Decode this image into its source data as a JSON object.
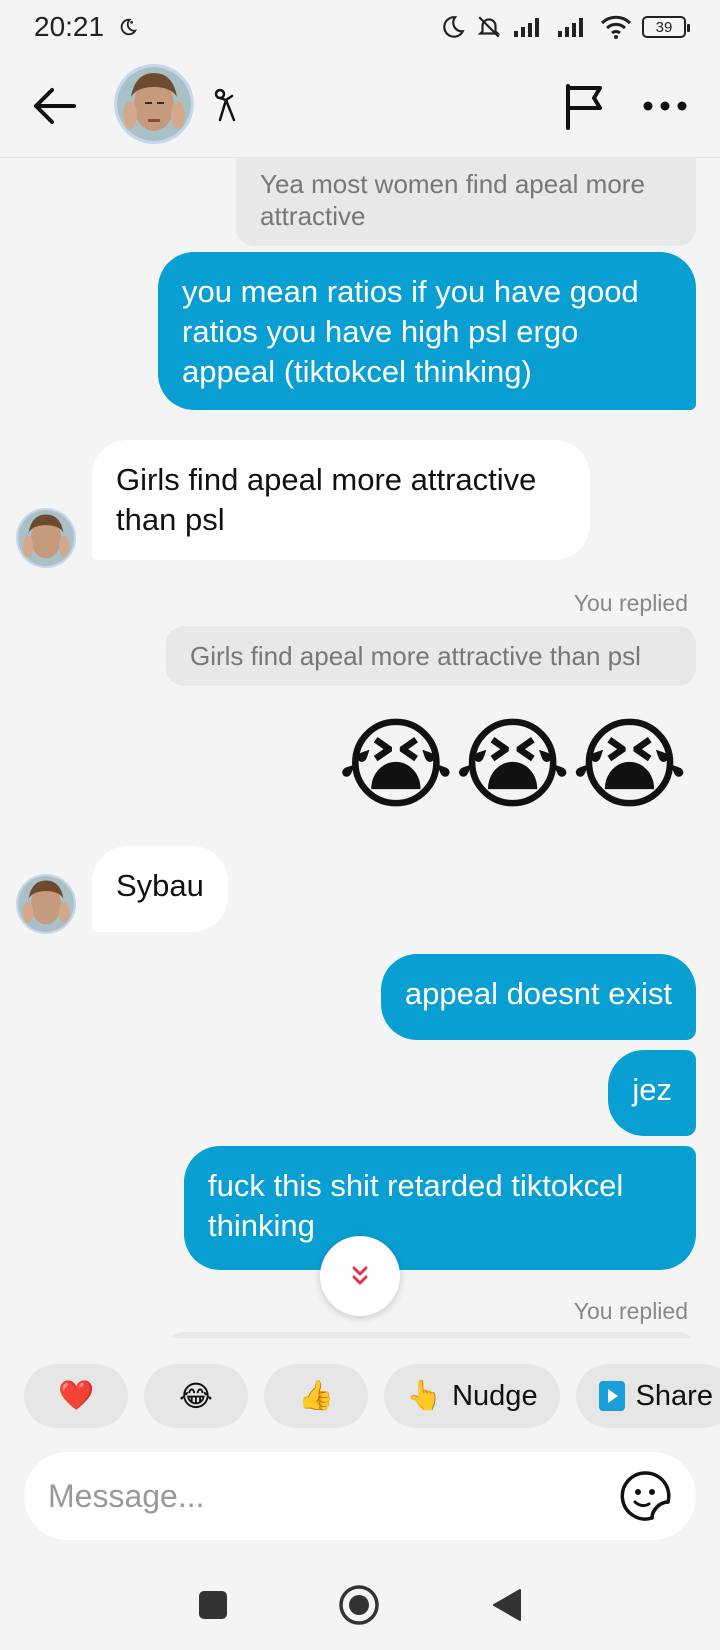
{
  "status_bar": {
    "time": "20:21",
    "battery": "39",
    "icons": [
      "moon-icon",
      "bell-off-icon",
      "signal-icon",
      "signal-icon",
      "wifi-icon",
      "battery-icon"
    ]
  },
  "header": {
    "back_icon": "arrow-left-icon",
    "avatar": "contact-avatar",
    "badge_icon": "stick-figure-icon",
    "flag_icon": "flag-icon",
    "more_icon": "more-horizontal-icon"
  },
  "messages": {
    "m1_quote": "Yea most women find apeal more attractive",
    "m2_out": "you mean ratios if you have good ratios you have high psl ergo appeal (tiktokcel thinking)",
    "m3_in": "Girls find apeal more attractive than psl",
    "m4_replied_label": "You replied",
    "m4_quote": "Girls find apeal more attractive than psl",
    "m4_emojis": "😭😭😭",
    "m5_in": "Sybau",
    "m6_out": "appeal doesnt exist",
    "m7_out": "jez",
    "m8_out": "fuck this shit retarded tiktokcel thinking",
    "m9_replied_label": "You replied"
  },
  "quick_replies": {
    "heart": "❤️",
    "laugh": "😂",
    "thumbs_up": "👍",
    "nudge_emoji": "👆",
    "nudge_label": "Nudge",
    "share_label": "Share"
  },
  "composer": {
    "placeholder": "Message..."
  },
  "colors": {
    "outgoing_bubble": "#0a9fd2",
    "incoming_bubble": "#ffffff",
    "background": "#f4f4f4",
    "share_icon": "#1a9fd8"
  }
}
